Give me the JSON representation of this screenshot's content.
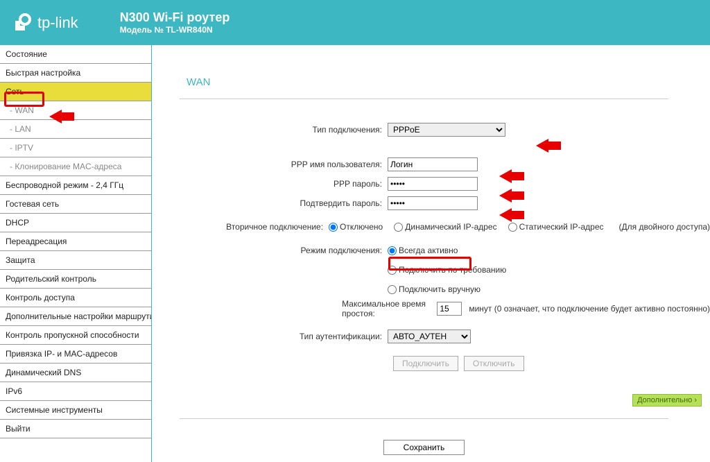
{
  "header": {
    "brand": "tp-link",
    "title": "N300 Wi-Fi роутер",
    "model": "Модель № TL-WR840N"
  },
  "sidebar": {
    "items": [
      "Состояние",
      "Быстрая настройка",
      "Сеть",
      "- WAN",
      "- LAN",
      "- IPTV",
      "- Клонирование MAC-адреса",
      "Беспроводной режим - 2,4 ГГц",
      "Гостевая сеть",
      "DHCP",
      "Переадресация",
      "Защита",
      "Родительский контроль",
      "Контроль доступа",
      "Дополнительные настройки маршрутизации",
      "Контроль пропускной способности",
      "Привязка IP- и MAC-адресов",
      "Динамический DNS",
      "IPv6",
      "Системные инструменты",
      "Выйти"
    ]
  },
  "page": {
    "title": "WAN"
  },
  "form": {
    "conn_type_label": "Тип подключения:",
    "conn_type_value": "PPPoE",
    "ppp_user_label": "PPP имя пользователя:",
    "ppp_user_value": "Логин",
    "ppp_pass_label": "PPP пароль:",
    "ppp_pass_value": "•••••",
    "ppp_pass2_label": "Подтвердить пароль:",
    "ppp_pass2_value": "•••••",
    "sec_conn_label": "Вторичное подключение:",
    "sec_off": "Отключено",
    "sec_dyn": "Динамический IP-адрес",
    "sec_stat": "Статический IP-адрес",
    "sec_hint": "(Для двойного доступа)",
    "mode_label": "Режим подключения:",
    "mode_always": "Всегда активно",
    "mode_demand": "Подключить по требованию",
    "mode_manual": "Подключить вручную",
    "idle_label": "Максимальное время простоя:",
    "idle_value": "15",
    "idle_hint": "минут (0 означает, что подключение будет активно постоянно)",
    "auth_label": "Тип аутентификации:",
    "auth_value": "АВТО_АУТЕН",
    "connect": "Подключить",
    "disconnect": "Отключить",
    "additional": "Дополнительно",
    "save": "Сохранить"
  }
}
